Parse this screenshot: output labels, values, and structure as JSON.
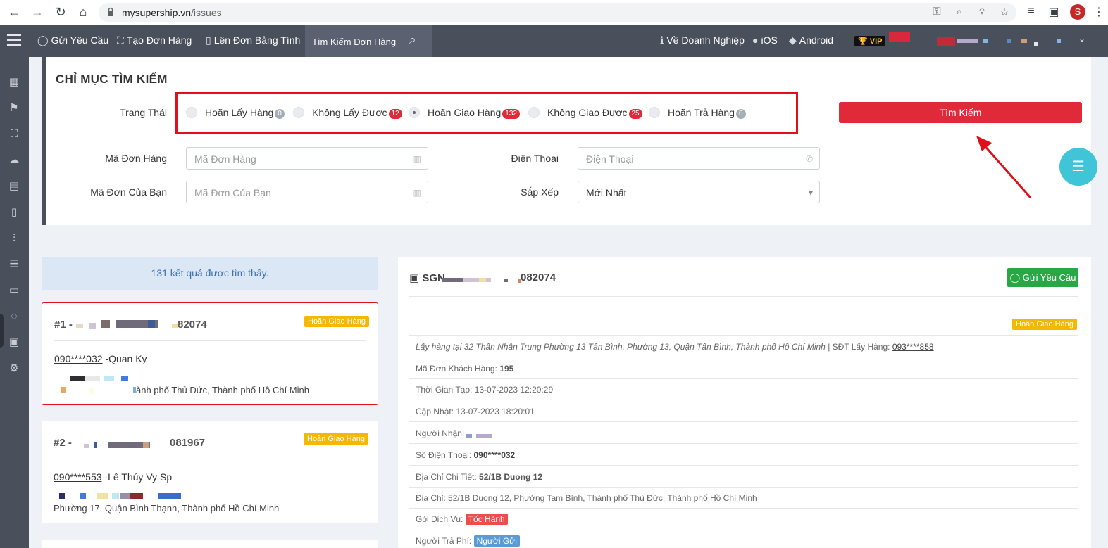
{
  "browser": {
    "host": "mysupership.vn",
    "path": "/issues",
    "profile_initial": "S"
  },
  "topnav": {
    "items": [
      {
        "label": "Gửi Yêu Cầu",
        "icon": "chat-icon"
      },
      {
        "label": "Tạo Đơn Hàng",
        "icon": "scan-icon"
      },
      {
        "label": "Lên Đơn Bảng Tính",
        "icon": "book-icon"
      }
    ],
    "search_tab": "Tìm Kiếm Đơn Hàng",
    "about": "Về Doanh Nghiệp",
    "ios": "iOS",
    "android": "Android",
    "vip": "🏆 VIP"
  },
  "search": {
    "title": "CHỈ MỤC TÌM KIẾM",
    "status_label": "Trạng Thái",
    "statuses": [
      {
        "label": "Hoãn Lấy Hàng",
        "count": "0",
        "color": "grey",
        "checked": false
      },
      {
        "label": "Không Lấy Được",
        "count": "12",
        "color": "red",
        "checked": false
      },
      {
        "label": "Hoãn Giao Hàng",
        "count": "132",
        "color": "red",
        "checked": true
      },
      {
        "label": "Không Giao Được",
        "count": "25",
        "color": "red",
        "checked": false
      },
      {
        "label": "Hoãn Trả Hàng",
        "count": "0",
        "color": "grey",
        "checked": false
      }
    ],
    "button": "Tìm Kiếm",
    "order_code_label": "Mã Đơn Hàng",
    "order_code_placeholder": "Mã Đơn Hàng",
    "phone_label": "Điện Thoại",
    "phone_placeholder": "Điện Thoại",
    "your_code_label": "Mã Đơn Của Bạn",
    "your_code_placeholder": "Mã Đơn Của Bạn",
    "sort_label": "Sắp Xếp",
    "sort_value": "Mới Nhất"
  },
  "results": {
    "count_text": "131 kết quả được tìm thấy.",
    "items": [
      {
        "num": "#1 -",
        "code_tail": "82074",
        "status": "Hoãn Giao Hàng",
        "phone": "090****032",
        "name": " -Quan Ky",
        "addr": "ành phố Thủ Đức, Thành phố Hồ Chí Minh"
      },
      {
        "num": "#2 -",
        "code_tail": "081967",
        "status": "Hoãn Giao Hàng",
        "phone": "090****553",
        "name": " -Lê Thúy Vy Sp",
        "addr": "Phường 17, Quận Bình Thạnh, Thành phố Hồ Chí Minh"
      }
    ]
  },
  "detail": {
    "code_prefix": "SGN",
    "code_tail": "082074",
    "request_button": "Gửi Yêu Cầu",
    "status": "Hoãn Giao Hàng",
    "pickup": "Lấy hàng tại 32 Thân Nhân Trung Phường 13 Tân Bình, Phường 13, Quận Tân Bình, Thành phố Hồ Chí Minh",
    "pickup_phone_label": " | SĐT Lấy Hàng: ",
    "pickup_phone": "093****858",
    "customer_code_label": "Mã Đơn Khách Hàng: ",
    "customer_code": "195",
    "created_label": "Thời Gian Tạo: ",
    "created": "13-07-2023 12:20:29",
    "updated_label": "Cập Nhật: ",
    "updated": "13-07-2023 18:20:01",
    "receiver_label": "Người Nhận:",
    "phone_label": "Số Điện Thoại: ",
    "phone": "090****032",
    "addr_detail_label": "Địa Chỉ Chi Tiết: ",
    "addr_detail": "52/1B Duong 12",
    "addr_label": "Địa Chỉ: ",
    "addr": "52/1B Duong 12, Phường Tam Bình, Thành phố Thủ Đức, Thành phố Hồ Chí Minh",
    "service_label": "Gói Dịch Vụ: ",
    "service": "Tốc Hành",
    "payer_label": "Người Trả Phí: ",
    "payer": "Người Gửi"
  }
}
